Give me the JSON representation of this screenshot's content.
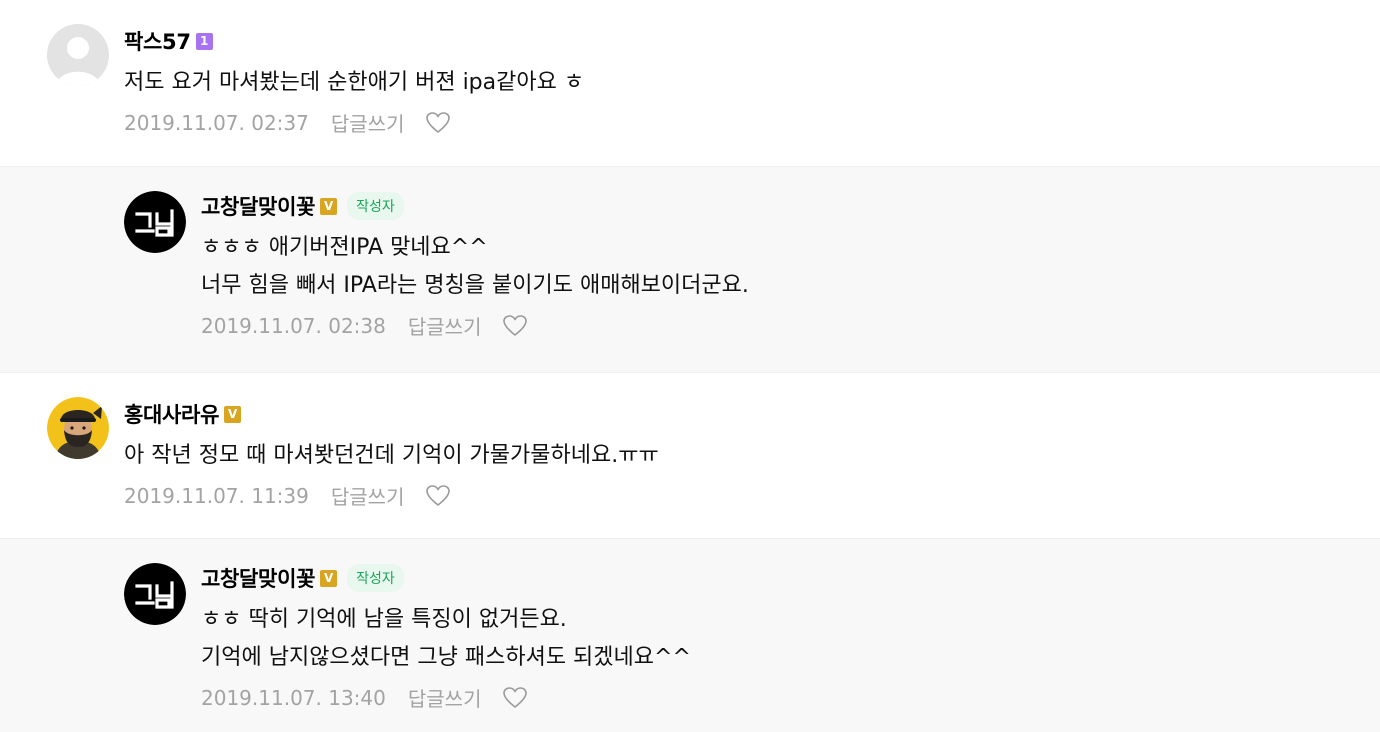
{
  "comments": [
    {
      "nickname": "팍스57",
      "level_badge": "1",
      "text_lines": [
        "저도 요거 마셔봤는데 순한애기 버젼 ipa같아요 ㅎ"
      ],
      "date": "2019.11.07. 02:37",
      "reply_label": "답글쓰기",
      "avatar": "default-avatar-icon"
    },
    {
      "nickname": "고창달맞이꽃",
      "level_badge": "V",
      "author_tag": "작성자",
      "text_lines": [
        "ㅎㅎㅎ 애기버젼IPA 맞네요^^",
        "너무 힘을 빼서 IPA라는 명칭을 붙이기도 애매해보이더군요."
      ],
      "date": "2019.11.07. 02:38",
      "reply_label": "답글쓰기",
      "avatar": "logo-avatar"
    },
    {
      "nickname": "홍대사라유",
      "level_badge": "V",
      "text_lines": [
        "아 작년 정모 때 마셔봣던건데 기억이 가물가물하네요.ㅠㅠ"
      ],
      "date": "2019.11.07. 11:39",
      "reply_label": "답글쓰기",
      "avatar": "cartoon-avatar"
    },
    {
      "nickname": "고창달맞이꽃",
      "level_badge": "V",
      "author_tag": "작성자",
      "text_lines": [
        "ㅎㅎ 딱히 기억에 남을 특징이 없거든요.",
        "기억에 남지않으셨다면 그냥 패스하셔도 되겠네요^^"
      ],
      "date": "2019.11.07. 13:40",
      "reply_label": "답글쓰기",
      "avatar": "logo-avatar"
    }
  ],
  "colors": {
    "badge_level1": "#a873f0",
    "badge_v": "#d9a520",
    "author_tag_bg": "#e9f8ef",
    "author_tag_text": "#1aa55a",
    "reply_bg": "#f8f8f8",
    "meta_text": "#a3a3a3"
  }
}
